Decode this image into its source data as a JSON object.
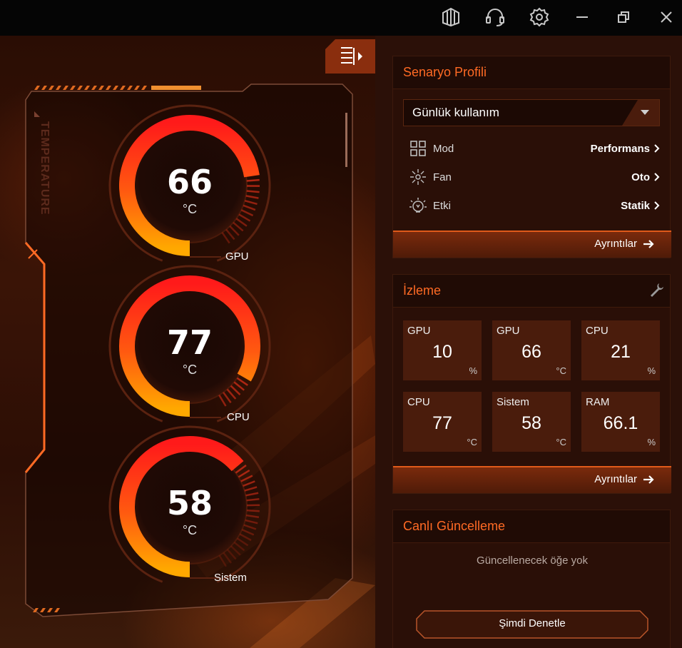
{
  "titlebar": {
    "icons": [
      "logo-icon",
      "headset-icon",
      "settings-gear-icon",
      "minimize-icon",
      "restore-icon",
      "close-icon"
    ]
  },
  "left_panel": {
    "section_label": "TEMPERATURE",
    "gauges": [
      {
        "label": "GPU",
        "value": "66",
        "unit": "°C",
        "level": 0.66
      },
      {
        "label": "CPU",
        "value": "77",
        "unit": "°C",
        "level": 0.77
      },
      {
        "label": "Sistem",
        "value": "58",
        "unit": "°C",
        "level": 0.58
      }
    ]
  },
  "scenario": {
    "title": "Senaryo Profili",
    "selected_profile": "Günlük kullanım",
    "rows": [
      {
        "icon": "grid-mode-icon",
        "label": "Mod",
        "value": "Performans"
      },
      {
        "icon": "fan-icon",
        "label": "Fan",
        "value": "Oto"
      },
      {
        "icon": "effect-bulb-icon",
        "label": "Etki",
        "value": "Statik"
      }
    ],
    "details_label": "Ayrıntılar"
  },
  "monitoring": {
    "title": "İzleme",
    "tiles": [
      {
        "name": "GPU",
        "value": "10",
        "unit": "%"
      },
      {
        "name": "GPU",
        "value": "66",
        "unit": "°C"
      },
      {
        "name": "CPU",
        "value": "21",
        "unit": "%"
      },
      {
        "name": "CPU",
        "value": "77",
        "unit": "°C"
      },
      {
        "name": "Sistem",
        "value": "58",
        "unit": "°C"
      },
      {
        "name": "RAM",
        "value": "66.1",
        "unit": "%"
      }
    ],
    "details_label": "Ayrıntılar"
  },
  "live_update": {
    "title": "Canlı Güncelleme",
    "empty_message": "Güncellenecek öğe yok",
    "check_button": "Şimdi Denetle"
  },
  "colors": {
    "accent": "#ff6a24",
    "gauge_red": "#ff1a1a",
    "gauge_orange": "#ffa000",
    "panel_bg": "#2a0f07"
  }
}
